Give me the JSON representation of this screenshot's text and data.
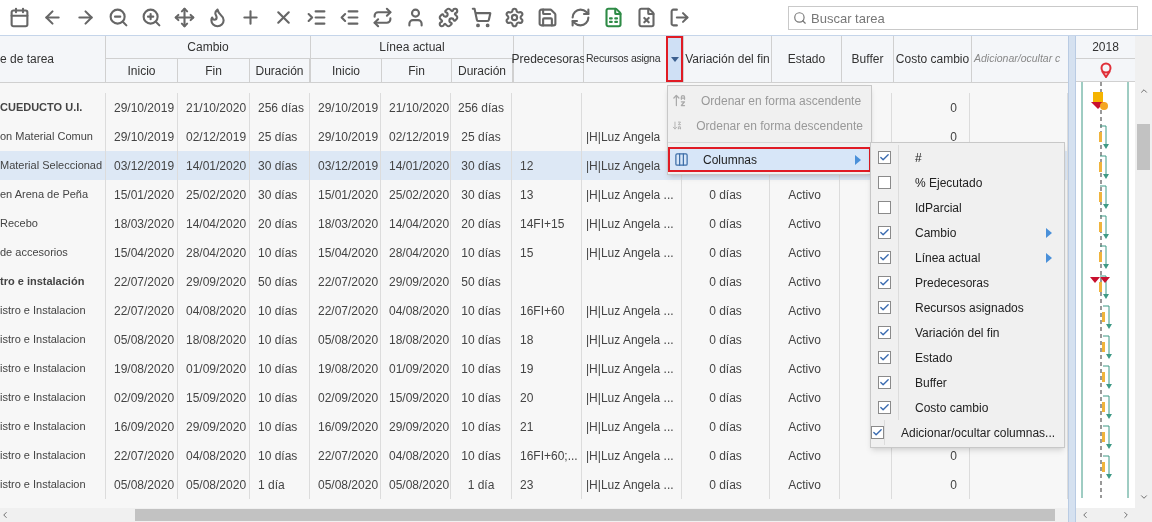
{
  "toolbar": {
    "search": {
      "placeholder": "Buscar tarea"
    }
  },
  "table": {
    "columns": [
      {
        "label": "e de tarea"
      },
      {
        "label": "Cambio",
        "children": [
          {
            "label": "Inicio"
          },
          {
            "label": "Fin"
          },
          {
            "label": "Duración"
          }
        ]
      },
      {
        "label": "Línea actual",
        "children": [
          {
            "label": "Inicio"
          },
          {
            "label": "Fin"
          },
          {
            "label": "Duración"
          }
        ]
      },
      {
        "label": "Predecesoras"
      },
      {
        "label": "Recursos asigna",
        "menu_button": {
          "highlighted": true
        }
      },
      {
        "label": "Variación del fin"
      },
      {
        "label": "Estado"
      },
      {
        "label": "Buffer"
      },
      {
        "label": "Costo cambio"
      },
      {
        "label": "Adicionar/ocultar c",
        "italic": true
      }
    ],
    "rows": [
      {
        "bold": true,
        "selected": false,
        "name": "CUEDUCTO U.I.",
        "c_inicio": "29/10/2019",
        "c_fin": "21/10/2020",
        "c_dur": "256 días",
        "l_inicio": "29/10/2019",
        "l_fin": "21/10/2020",
        "l_dur": "256 días",
        "costo": "0"
      },
      {
        "bold": false,
        "selected": false,
        "name": "on Material Comun",
        "c_inicio": "29/10/2019",
        "c_fin": "02/12/2019",
        "c_dur": "25 días",
        "l_inicio": "29/10/2019",
        "l_fin": "02/12/2019",
        "l_dur": "25 días",
        "recursos": "|H|Luz Angela",
        "costo": "0"
      },
      {
        "bold": false,
        "selected": true,
        "name": "Material Seleccionad",
        "c_inicio": "03/12/2019",
        "c_fin": "14/01/2020",
        "c_dur": "30 días",
        "l_inicio": "03/12/2019",
        "l_fin": "14/01/2020",
        "l_dur": "30 días",
        "pred": "12",
        "recursos": "|H|Luz Angela"
      },
      {
        "bold": false,
        "selected": false,
        "name": "en Arena de Peña",
        "c_inicio": "15/01/2020",
        "c_fin": "25/02/2020",
        "c_dur": "30 días",
        "l_inicio": "15/01/2020",
        "l_fin": "25/02/2020",
        "l_dur": "30 días",
        "pred": "13",
        "recursos": "|H|Luz Angela ...",
        "variacion": "0 días",
        "estado": "Activo"
      },
      {
        "bold": false,
        "selected": false,
        "name": "Recebo",
        "c_inicio": "18/03/2020",
        "c_fin": "14/04/2020",
        "c_dur": "20 días",
        "l_inicio": "18/03/2020",
        "l_fin": "14/04/2020",
        "l_dur": "20 días",
        "pred": "14FI+15",
        "recursos": "|H|Luz Angela ...",
        "variacion": "0 días",
        "estado": "Activo"
      },
      {
        "bold": false,
        "selected": false,
        "name": "de accesorios",
        "c_inicio": "15/04/2020",
        "c_fin": "28/04/2020",
        "c_dur": "10 días",
        "l_inicio": "15/04/2020",
        "l_fin": "28/04/2020",
        "l_dur": "10 días",
        "pred": "15",
        "recursos": "|H|Luz Angela ...",
        "variacion": "0 días",
        "estado": "Activo"
      },
      {
        "bold": true,
        "selected": false,
        "name": "tro e instalación",
        "c_inicio": "22/07/2020",
        "c_fin": "29/09/2020",
        "c_dur": "50 días",
        "l_inicio": "22/07/2020",
        "l_fin": "29/09/2020",
        "l_dur": "50 días",
        "variacion": "0 días",
        "estado": "Activo"
      },
      {
        "bold": false,
        "selected": false,
        "name": "istro e Instalacion",
        "c_inicio": "22/07/2020",
        "c_fin": "04/08/2020",
        "c_dur": "10 días",
        "l_inicio": "22/07/2020",
        "l_fin": "04/08/2020",
        "l_dur": "10 días",
        "pred": "16FI+60",
        "recursos": "|H|Luz Angela ...",
        "variacion": "0 días",
        "estado": "Activo"
      },
      {
        "bold": false,
        "selected": false,
        "name": "istro e Instalacion",
        "c_inicio": "05/08/2020",
        "c_fin": "18/08/2020",
        "c_dur": "10 días",
        "l_inicio": "05/08/2020",
        "l_fin": "18/08/2020",
        "l_dur": "10 días",
        "pred": "18",
        "recursos": "|H|Luz Angela ...",
        "variacion": "0 días",
        "estado": "Activo"
      },
      {
        "bold": false,
        "selected": false,
        "name": "istro e Instalacion",
        "c_inicio": "19/08/2020",
        "c_fin": "01/09/2020",
        "c_dur": "10 días",
        "l_inicio": "19/08/2020",
        "l_fin": "01/09/2020",
        "l_dur": "10 días",
        "pred": "19",
        "recursos": "|H|Luz Angela ...",
        "variacion": "0 días",
        "estado": "Activo"
      },
      {
        "bold": false,
        "selected": false,
        "name": "istro e Instalacion",
        "c_inicio": "02/09/2020",
        "c_fin": "15/09/2020",
        "c_dur": "10 días",
        "l_inicio": "02/09/2020",
        "l_fin": "15/09/2020",
        "l_dur": "10 días",
        "pred": "20",
        "recursos": "|H|Luz Angela ...",
        "variacion": "0 días",
        "estado": "Activo"
      },
      {
        "bold": false,
        "selected": false,
        "name": "istro e Instalacion",
        "c_inicio": "16/09/2020",
        "c_fin": "29/09/2020",
        "c_dur": "10 días",
        "l_inicio": "16/09/2020",
        "l_fin": "29/09/2020",
        "l_dur": "10 días",
        "pred": "21",
        "recursos": "|H|Luz Angela ...",
        "variacion": "0 días",
        "estado": "Activo"
      },
      {
        "bold": false,
        "selected": false,
        "name": "istro e Instalacion",
        "c_inicio": "22/07/2020",
        "c_fin": "04/08/2020",
        "c_dur": "10 días",
        "l_inicio": "22/07/2020",
        "l_fin": "04/08/2020",
        "l_dur": "10 días",
        "pred": "16FI+60;...",
        "recursos": "|H|Luz Angela ...",
        "variacion": "0 días",
        "estado": "Activo",
        "costo": "0"
      },
      {
        "bold": false,
        "selected": false,
        "name": "istro e Instalacion",
        "c_inicio": "05/08/2020",
        "c_fin": "05/08/2020",
        "c_dur": "1 día",
        "l_inicio": "05/08/2020",
        "l_fin": "05/08/2020",
        "l_dur": "1 día",
        "pred": "23",
        "recursos": "|H|Luz Angela ...",
        "variacion": "0 días",
        "estado": "Activo",
        "costo": "0"
      }
    ]
  },
  "gantt": {
    "year": "2018"
  },
  "column_menu": {
    "items": [
      {
        "kind": "sort_ascending",
        "label": "Ordenar en forma ascendente",
        "disabled": true,
        "highlighted": false
      },
      {
        "kind": "sort_descending",
        "label": "Ordenar en forma descendente",
        "disabled": true,
        "highlighted": false
      },
      {
        "kind": "columns",
        "label": "Columnas",
        "disabled": false,
        "highlighted": true
      }
    ],
    "submenu": [
      {
        "label": "#",
        "checked": true,
        "has_submenu": false
      },
      {
        "label": "% Ejecutado",
        "checked": false,
        "has_submenu": false
      },
      {
        "label": "IdParcial",
        "checked": false,
        "has_submenu": false
      },
      {
        "label": "Cambio",
        "checked": true,
        "has_submenu": true
      },
      {
        "label": "Línea actual",
        "checked": true,
        "has_submenu": true
      },
      {
        "label": "Predecesoras",
        "checked": true,
        "has_submenu": false
      },
      {
        "label": "Recursos asignados",
        "checked": true,
        "has_submenu": false
      },
      {
        "label": "Variación del fin",
        "checked": true,
        "has_submenu": false
      },
      {
        "label": "Estado",
        "checked": true,
        "has_submenu": false
      },
      {
        "label": "Buffer",
        "checked": true,
        "has_submenu": false
      },
      {
        "label": "Costo cambio",
        "checked": true,
        "has_submenu": false
      },
      {
        "label": "Adicionar/ocultar columnas...",
        "checked": true,
        "has_submenu": false
      }
    ]
  }
}
